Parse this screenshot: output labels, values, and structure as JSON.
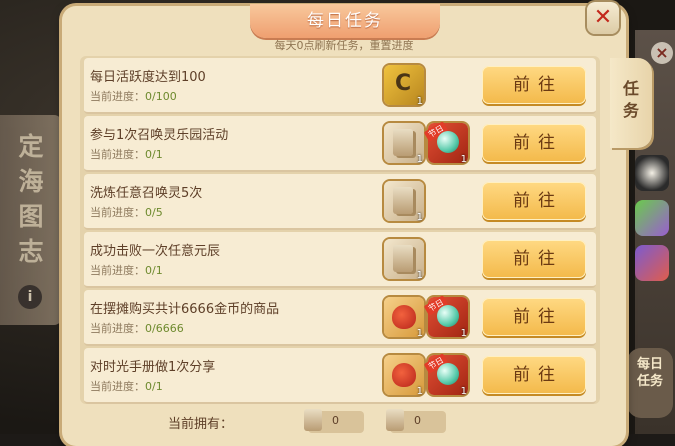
{
  "panel": {
    "title": "每日任务",
    "subtitle": "每天0点刷新任务，重置进度",
    "side_tab": "任务"
  },
  "background": {
    "left_scroll_chars": [
      "定",
      "海",
      "图",
      "志"
    ],
    "right_button": "每日任务"
  },
  "tasks": [
    {
      "name": "每日活跃度达到100",
      "progress_label": "当前进度：",
      "progress": "0/100",
      "button": "前往",
      "rewards": [
        {
          "icon": "card-icon",
          "qty": "1"
        }
      ]
    },
    {
      "name": "参与1次召唤灵乐园活动",
      "progress_label": "当前进度：",
      "progress": "0/1",
      "button": "前往",
      "rewards": [
        {
          "icon": "scroll-icon",
          "qty": "1"
        },
        {
          "icon": "orb-icon",
          "qty": "1"
        }
      ]
    },
    {
      "name": "洗炼任意召唤灵5次",
      "progress_label": "当前进度：",
      "progress": "0/5",
      "button": "前往",
      "rewards": [
        {
          "icon": "scroll-icon",
          "qty": "1"
        }
      ]
    },
    {
      "name": "成功击败一次任意元辰",
      "progress_label": "当前进度：",
      "progress": "0/1",
      "button": "前往",
      "rewards": [
        {
          "icon": "scroll-icon",
          "qty": "1"
        }
      ]
    },
    {
      "name": "在摆摊购买共计6666金币的商品",
      "progress_label": "当前进度：",
      "progress": "0/6666",
      "button": "前往",
      "rewards": [
        {
          "icon": "bag-icon",
          "qty": "1"
        },
        {
          "icon": "orb-icon",
          "qty": "1"
        }
      ]
    },
    {
      "name": "对时光手册做1次分享",
      "progress_label": "当前进度：",
      "progress": "0/1",
      "button": "前往",
      "rewards": [
        {
          "icon": "bag-icon",
          "qty": "1"
        },
        {
          "icon": "orb-icon",
          "qty": "1"
        }
      ]
    }
  ],
  "badge_label": "节日",
  "footer": {
    "label": "当前拥有：",
    "owned": [
      {
        "icon": "scroll-icon",
        "value": "0"
      },
      {
        "icon": "scroll-icon",
        "value": "0"
      }
    ]
  },
  "colors": {
    "panel_bg": "#efe0bd",
    "button_gold": "#f3b94a",
    "title_banner": "#ef9f70",
    "close_red": "#c3281b",
    "progress_green": "#6e8a2e"
  }
}
